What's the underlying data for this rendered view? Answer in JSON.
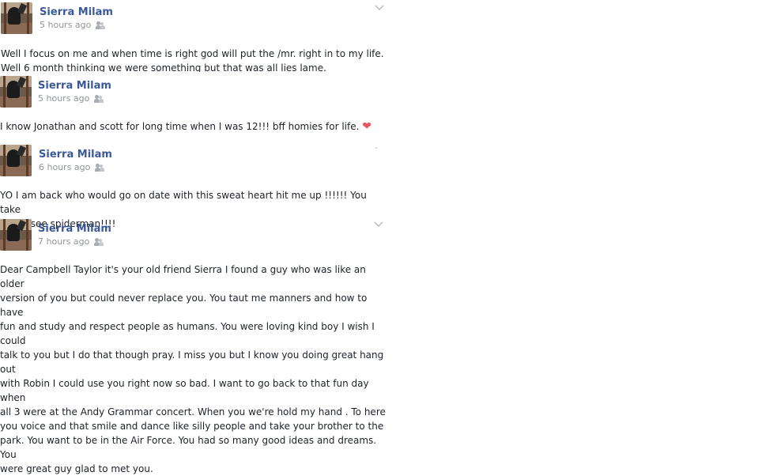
{
  "posts": [
    {
      "author": "Sierra Milam",
      "time": "5 hours ago",
      "text_lines": [
        "Well I focus on me and when time is right god will put the /mr. right in to my life.",
        "Well 6 month thinking we were something but that was all lies lame."
      ]
    },
    {
      "author": "Sierra Milam",
      "time": "5 hours ago",
      "text": "I know Jonathan and scott for long time when I was 12!!! bff homies for life.",
      "emoji": "❤"
    },
    {
      "author": "Sierra Milam",
      "time": "6 hours ago",
      "text_lines": [
        "YO I am back who would go on date with this sweat heart hit me up !!!!!! You take",
        "me to see spiderman!!!!"
      ]
    },
    {
      "author": "Sierra Milam",
      "time": "7 hours ago",
      "text_lines": [
        "Dear Campbell Taylor it's your old friend Sierra I found a guy who was like an older",
        "version of you but could never replace you. You taut me manners and how to have",
        "fun and study and respect people as humans. You were loving kind boy I wish I could",
        "talk to you but I do that though pray. I miss you but I know you doing great hang out",
        "with Robin I could use you right now so bad. I want to go back to that fun day when",
        "all 3 were at the Andy Grammar concert. When you we're hold my hand . To here",
        "you voice and that smile and dance like silly people and take your brother to the",
        "park. You want to be in the Air Force. You had so many good ideas and dreams. You",
        "were great guy glad to met you."
      ]
    }
  ]
}
